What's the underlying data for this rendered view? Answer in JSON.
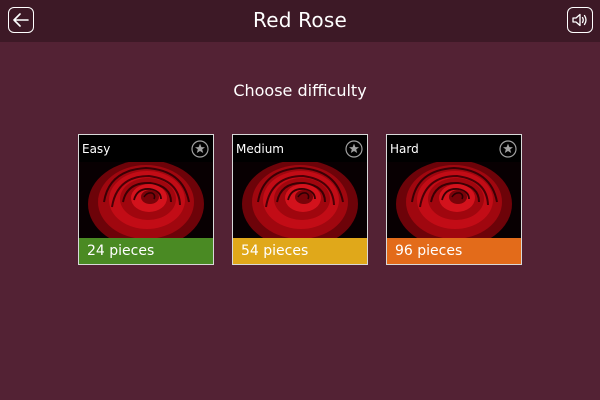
{
  "header": {
    "title": "Red Rose",
    "back_icon": "back-arrow-icon",
    "sound_icon": "speaker-icon"
  },
  "main": {
    "subtitle": "Choose difficulty",
    "difficulties": [
      {
        "label": "Easy",
        "pieces": "24 pieces",
        "color": "#4a8a23"
      },
      {
        "label": "Medium",
        "pieces": "54 pieces",
        "color": "#e0a81a"
      },
      {
        "label": "Hard",
        "pieces": "96 pieces",
        "color": "#e36b1a"
      }
    ]
  },
  "colors": {
    "background": "#532234",
    "top_bar": "#3d1926"
  }
}
